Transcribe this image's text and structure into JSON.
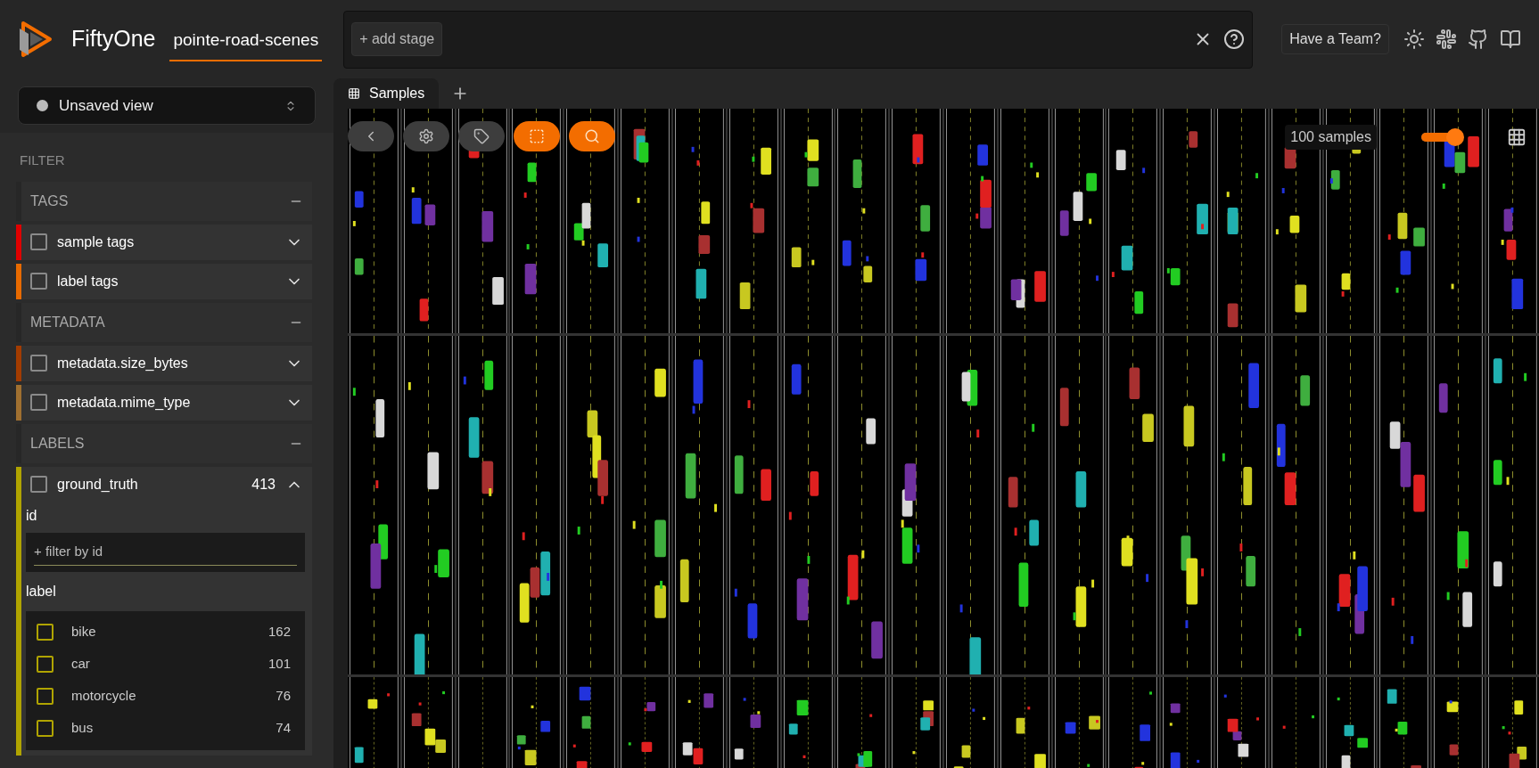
{
  "header": {
    "app_name": "FiftyOne",
    "dataset": "pointe-road-scenes",
    "add_stage": "+ add stage",
    "team_button": "Have a Team?"
  },
  "sidebar": {
    "view_selector": "Unsaved view",
    "filter_heading": "FILTER",
    "groups": [
      {
        "title": "TAGS",
        "expanded": true,
        "fields": [
          {
            "name": "sample tags",
            "color": "#e00000",
            "checked": false,
            "expanded": false
          },
          {
            "name": "label tags",
            "color": "#e86a00",
            "checked": false,
            "expanded": false
          }
        ]
      },
      {
        "title": "METADATA",
        "expanded": true,
        "fields": [
          {
            "name": "metadata.size_bytes",
            "color": "#a33c00",
            "checked": false,
            "expanded": false
          },
          {
            "name": "metadata.mime_type",
            "color": "#a07030",
            "checked": false,
            "expanded": false
          }
        ]
      },
      {
        "title": "LABELS",
        "expanded": true,
        "fields": [
          {
            "name": "ground_truth",
            "color": "#b0a400",
            "checked": false,
            "expanded": true,
            "count": "413",
            "id_label": "id",
            "id_placeholder": "+ filter by id",
            "label_heading": "label",
            "values": [
              {
                "name": "bike",
                "count": "162",
                "checked": false
              },
              {
                "name": "car",
                "count": "101",
                "checked": false
              },
              {
                "name": "motorcycle",
                "count": "76",
                "checked": false
              },
              {
                "name": "bus",
                "count": "74",
                "checked": false
              }
            ]
          }
        ]
      }
    ]
  },
  "tabs": [
    {
      "label": "Samples",
      "selected": true
    }
  ],
  "toolbar": [
    {
      "kind": "back",
      "active": false
    },
    {
      "kind": "settings",
      "active": false
    },
    {
      "kind": "tag",
      "active": false
    },
    {
      "kind": "select",
      "active": true
    },
    {
      "kind": "search",
      "active": true
    }
  ],
  "grid": {
    "count": "100 samples",
    "zoom": {
      "level": 0.82
    }
  }
}
